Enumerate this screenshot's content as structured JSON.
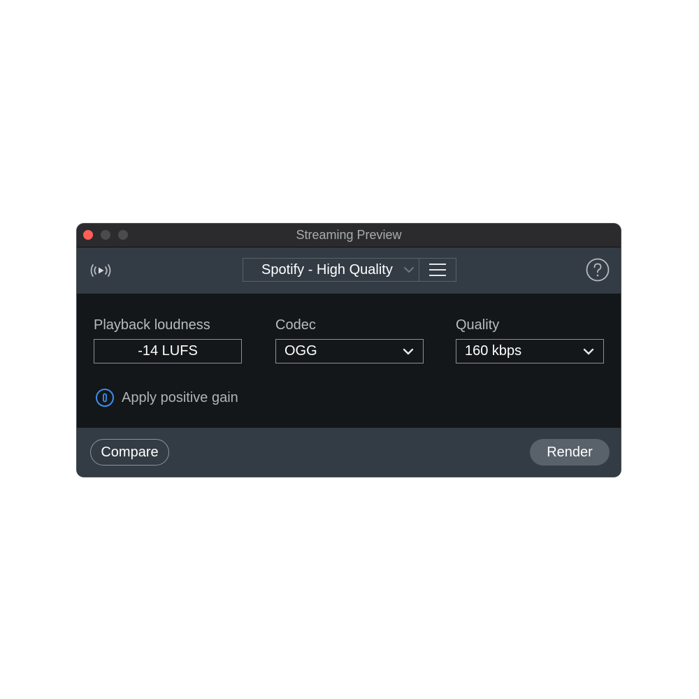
{
  "window": {
    "title": "Streaming Preview"
  },
  "toolbar": {
    "broadcast_icon": "broadcast-play-icon",
    "preset": "Spotify - High Quality",
    "menu_icon": "hamburger-menu-icon",
    "help_icon": "question-mark-icon"
  },
  "settings": {
    "loudness": {
      "label": "Playback loudness",
      "value": "-14  LUFS"
    },
    "codec": {
      "label": "Codec",
      "value": "OGG"
    },
    "quality": {
      "label": "Quality",
      "value": "160 kbps"
    },
    "positive_gain": {
      "label": "Apply positive gain",
      "enabled": false
    }
  },
  "footer": {
    "compare_label": "Compare",
    "render_label": "Render"
  },
  "colors": {
    "close": "#fe5f57",
    "toolbar_bg": "#333b44",
    "content_bg": "#131719",
    "accent": "#3d8ef0"
  }
}
